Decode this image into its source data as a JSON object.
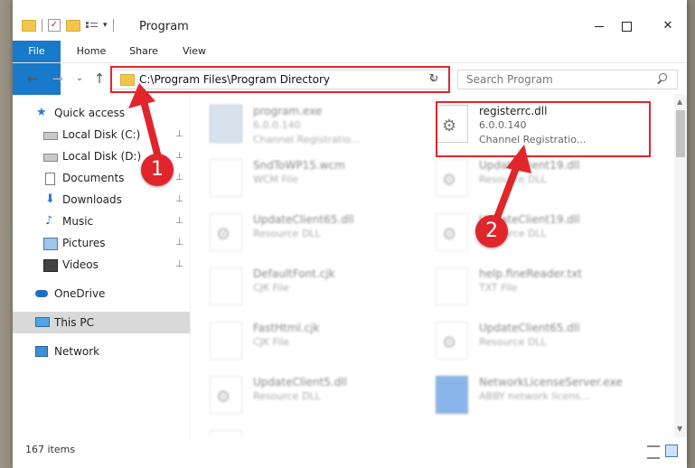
{
  "window": {
    "title": "Program",
    "minimize_label": "",
    "maximize_label": "",
    "close_label": "✕"
  },
  "ribbon": {
    "tabs": [
      "File",
      "Home",
      "Share",
      "View"
    ]
  },
  "nav": {
    "back_glyph": "←",
    "forward_glyph": "→",
    "recent_glyph": "⌄",
    "up_glyph": "↑",
    "address": "C:\\Program Files\\Program Directory",
    "address_dropdown": "⌄",
    "refresh_glyph": "↻",
    "search_placeholder": "Search Program"
  },
  "sidebar": {
    "items": [
      {
        "label": "Quick access",
        "icon": "star-icon",
        "pinned": false
      },
      {
        "label": "Local Disk (C:)",
        "icon": "drive-icon",
        "pinned": true
      },
      {
        "label": "Local Disk (D:)",
        "icon": "drive-icon",
        "pinned": true
      },
      {
        "label": "Documents",
        "icon": "documents-icon",
        "pinned": true
      },
      {
        "label": "Downloads",
        "icon": "download-icon",
        "pinned": true
      },
      {
        "label": "Music",
        "icon": "music-icon",
        "pinned": true
      },
      {
        "label": "Pictures",
        "icon": "pictures-icon",
        "pinned": true
      },
      {
        "label": "Videos",
        "icon": "videos-icon",
        "pinned": true
      },
      {
        "label": "OneDrive",
        "icon": "cloud-icon",
        "pinned": false
      },
      {
        "label": "This PC",
        "icon": "pc-icon",
        "pinned": false
      },
      {
        "label": "Network",
        "icon": "network-icon",
        "pinned": false
      }
    ],
    "pin_glyph": "📌"
  },
  "files": [
    {
      "name": "program.exe",
      "line1": "6.0.0.140",
      "line2": "Channel Registratio...",
      "icon": "exe-icon",
      "blurred": true
    },
    {
      "name": "registerrc.dll",
      "line1": "6.0.0.140",
      "line2": "Channel Registratio...",
      "icon": "dll-icon",
      "blurred": false
    },
    {
      "name": "SndToWP15.wcm",
      "line1": "WCM File",
      "line2": "",
      "icon": "file-icon",
      "blurred": true
    },
    {
      "name": "UpdateClient19.dll",
      "line1": "Resource DLL",
      "line2": "",
      "icon": "dll-icon",
      "blurred": true
    },
    {
      "name": "UpdateClient65.dll",
      "line1": "Resource DLL",
      "line2": "",
      "icon": "dll-icon",
      "blurred": true
    },
    {
      "name": "UpdateClient19.dll",
      "line1": "Resource DLL",
      "line2": "",
      "icon": "dll-icon",
      "blurred": true
    },
    {
      "name": "DefaultFont.cjk",
      "line1": "CJK File",
      "line2": "",
      "icon": "file-icon",
      "blurred": true
    },
    {
      "name": "help.fineReader.txt",
      "line1": "TXT File",
      "line2": "",
      "icon": "file-icon",
      "blurred": true
    },
    {
      "name": "FastHtml.cjk",
      "line1": "CJK File",
      "line2": "",
      "icon": "file-icon",
      "blurred": true
    },
    {
      "name": "UpdateClient65.dll",
      "line1": "Resource DLL",
      "line2": "",
      "icon": "dll-icon",
      "blurred": true
    },
    {
      "name": "UpdateClient5.dll",
      "line1": "Resource DLL",
      "line2": "",
      "icon": "dll-icon",
      "blurred": true
    },
    {
      "name": "NetworkLicenseServer.exe",
      "line1": "ABBY network licens...",
      "line2": "",
      "icon": "shortcut-icon",
      "blurred": true
    }
  ],
  "status": {
    "count": "167 items"
  },
  "annotations": {
    "badge1": "1",
    "badge2": "2",
    "color": "#e0262b"
  }
}
